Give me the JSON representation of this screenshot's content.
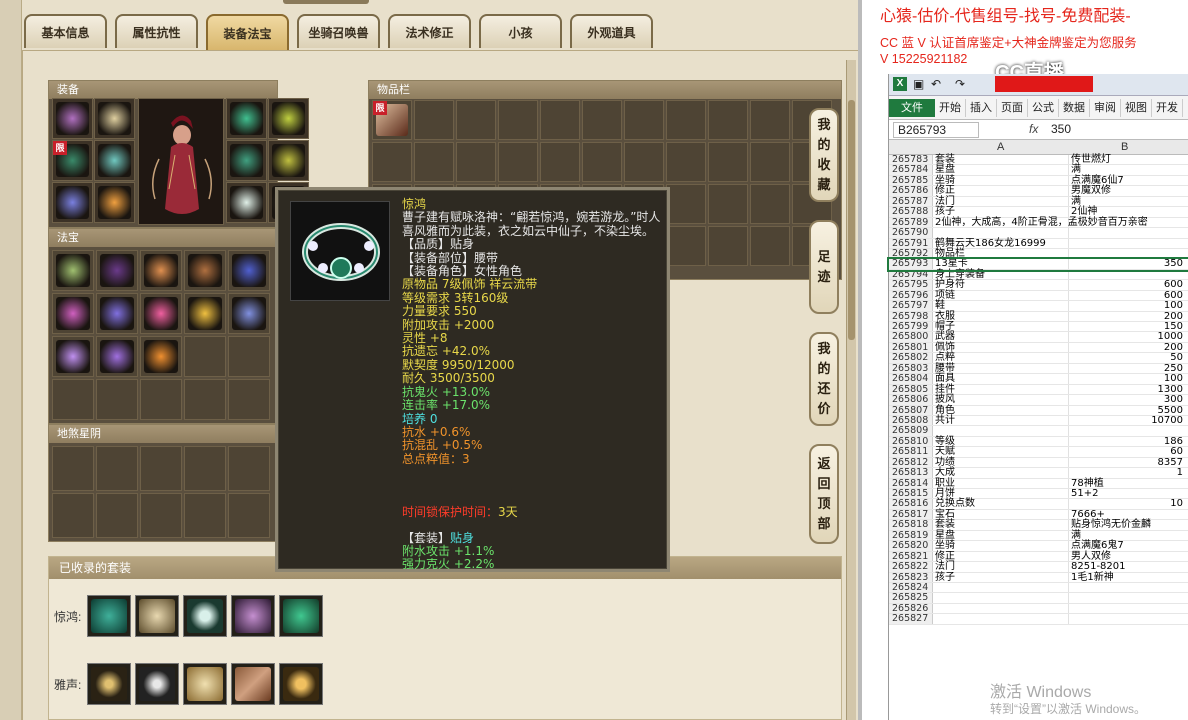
{
  "tabs": [
    "基本信息",
    "属性抗性",
    "装备法宝",
    "坐骑召唤兽",
    "法术修正",
    "小孩",
    "外观道具"
  ],
  "active_tab": 2,
  "panels": {
    "equip_title": "装备",
    "fabao_title": "法宝",
    "disha_title": "地煞星阴",
    "inventory_title": "物品栏",
    "limit_badge": "限"
  },
  "side_buttons": [
    {
      "label": "我\n的\n收\n藏"
    },
    {
      "label": "足\n迹"
    },
    {
      "label": "我\n的\n还\n价"
    },
    {
      "label": "返\n回\n顶\n部"
    }
  ],
  "tooltip": {
    "name": "惊鸿",
    "desc": "曹子建有赋咏洛神：“翩若惊鸿，婉若游龙。”时人喜风雅而为此装，衣之如云中仙子，不染尘埃。",
    "lines": [
      {
        "t": "【品质】贴身",
        "c": "w"
      },
      {
        "t": "【装备部位】腰带",
        "c": "w"
      },
      {
        "t": "【装备角色】女性角色",
        "c": "w"
      },
      {
        "t": "原物品 7级佩饰 祥云流带",
        "c": "y"
      },
      {
        "t": "等级需求 3转160级",
        "c": "y"
      },
      {
        "t": "力量要求 550",
        "c": "y"
      },
      {
        "t": "附加攻击 +2000",
        "c": "y"
      },
      {
        "t": "灵性 +8",
        "c": "y"
      },
      {
        "t": "抗遗忘 +42.0%",
        "c": "y"
      },
      {
        "t": "默契度 9950/12000",
        "c": "y"
      },
      {
        "t": "耐久 3500/3500",
        "c": "y"
      },
      {
        "t": "抗鬼火 +13.0%",
        "c": "g"
      },
      {
        "t": "连击率 +17.0%",
        "c": "g"
      },
      {
        "t": "培养 0",
        "c": "c"
      },
      {
        "t": "抗水 +0.6%",
        "c": "o"
      },
      {
        "t": "抗混乱 +0.5%",
        "c": "o"
      },
      {
        "t": "总点粹值：3",
        "c": "o"
      }
    ],
    "protect_label": "时间锁保护时间：",
    "protect_value": "3天",
    "set_label": "【套装】",
    "set_name": "贴身",
    "set_lines": [
      "附水攻击 +1.1%",
      "强力克火 +2.2%"
    ]
  },
  "suits": {
    "title": "已收录的套装",
    "rows": [
      {
        "label": "惊鸿:"
      },
      {
        "label": "雅声:"
      }
    ]
  },
  "ads": {
    "line1": "心猿-估价-代售组号-找号-免费配装-",
    "line2": "CC 蓝 V 认证首席鉴定+大神金牌鉴定为您服务",
    "line3": "V 15225921182",
    "logo": "CC直播"
  },
  "excel": {
    "ribbon": [
      "开始",
      "插入",
      "页面",
      "公式",
      "数据",
      "审阅",
      "视图",
      "开发"
    ],
    "file_tab": "文件",
    "namebox": "B265793",
    "fx": "fx",
    "formula": "350",
    "col_a": "A",
    "col_b": "B",
    "rows": [
      [
        "265783",
        "套装",
        "传世燃灯"
      ],
      [
        "265784",
        "星盘",
        "满"
      ],
      [
        "265785",
        "坐骑",
        "点满魔6仙7"
      ],
      [
        "265786",
        "修正",
        "男魔双修"
      ],
      [
        "265787",
        "法门",
        "满"
      ],
      [
        "265788",
        "孩子",
        "2仙神"
      ],
      [
        "265789",
        "2仙神，大成高，4阶正骨混，孟极妙音百万亲密",
        ""
      ],
      [
        "265790",
        "",
        ""
      ],
      [
        "265791",
        "鹤舞云天186女龙16999",
        ""
      ],
      [
        "265792",
        "物品栏",
        ""
      ],
      [
        "265793",
        "13星卡",
        "350"
      ],
      [
        "265794",
        "身上穿装备",
        ""
      ],
      [
        "265795",
        "护身符",
        "600"
      ],
      [
        "265796",
        "项链",
        "600"
      ],
      [
        "265797",
        "鞋",
        "100"
      ],
      [
        "265798",
        "衣服",
        "200"
      ],
      [
        "265799",
        "帽子",
        "150"
      ],
      [
        "265800",
        "武器",
        "1000"
      ],
      [
        "265801",
        "佩饰",
        "200"
      ],
      [
        "265802",
        "点粹",
        "50"
      ],
      [
        "265803",
        "腰带",
        "250"
      ],
      [
        "265804",
        "面具",
        "100"
      ],
      [
        "265805",
        "挂件",
        "1300"
      ],
      [
        "265806",
        "披风",
        "300"
      ],
      [
        "265807",
        "角色",
        "5500"
      ],
      [
        "265808",
        "共计",
        "10700"
      ],
      [
        "265809",
        "",
        ""
      ],
      [
        "265810",
        "等级",
        "186"
      ],
      [
        "265811",
        "天赋",
        "60"
      ],
      [
        "265812",
        "功绩",
        "8357"
      ],
      [
        "265813",
        "大成",
        "1"
      ],
      [
        "265814",
        "职业",
        "78神植"
      ],
      [
        "265815",
        "月饼",
        "51+2"
      ],
      [
        "265816",
        "兑换点数",
        "10"
      ],
      [
        "265817",
        "宝石",
        "7666+"
      ],
      [
        "265818",
        "套装",
        "贴身惊鸿无价金麟"
      ],
      [
        "265819",
        "星盘",
        "满"
      ],
      [
        "265820",
        "坐骑",
        "点满魔6鬼7"
      ],
      [
        "265821",
        "修正",
        "男人双修"
      ],
      [
        "265822",
        "法门",
        "8251-8201"
      ],
      [
        "265823",
        "孩子",
        "1毛1新神"
      ],
      [
        "265824",
        "",
        ""
      ],
      [
        "265825",
        "",
        ""
      ],
      [
        "265826",
        "",
        ""
      ],
      [
        "265827",
        "",
        ""
      ]
    ],
    "watermark1": "激活 Windows",
    "watermark2": "转到“设置”以激活 Windows。"
  }
}
